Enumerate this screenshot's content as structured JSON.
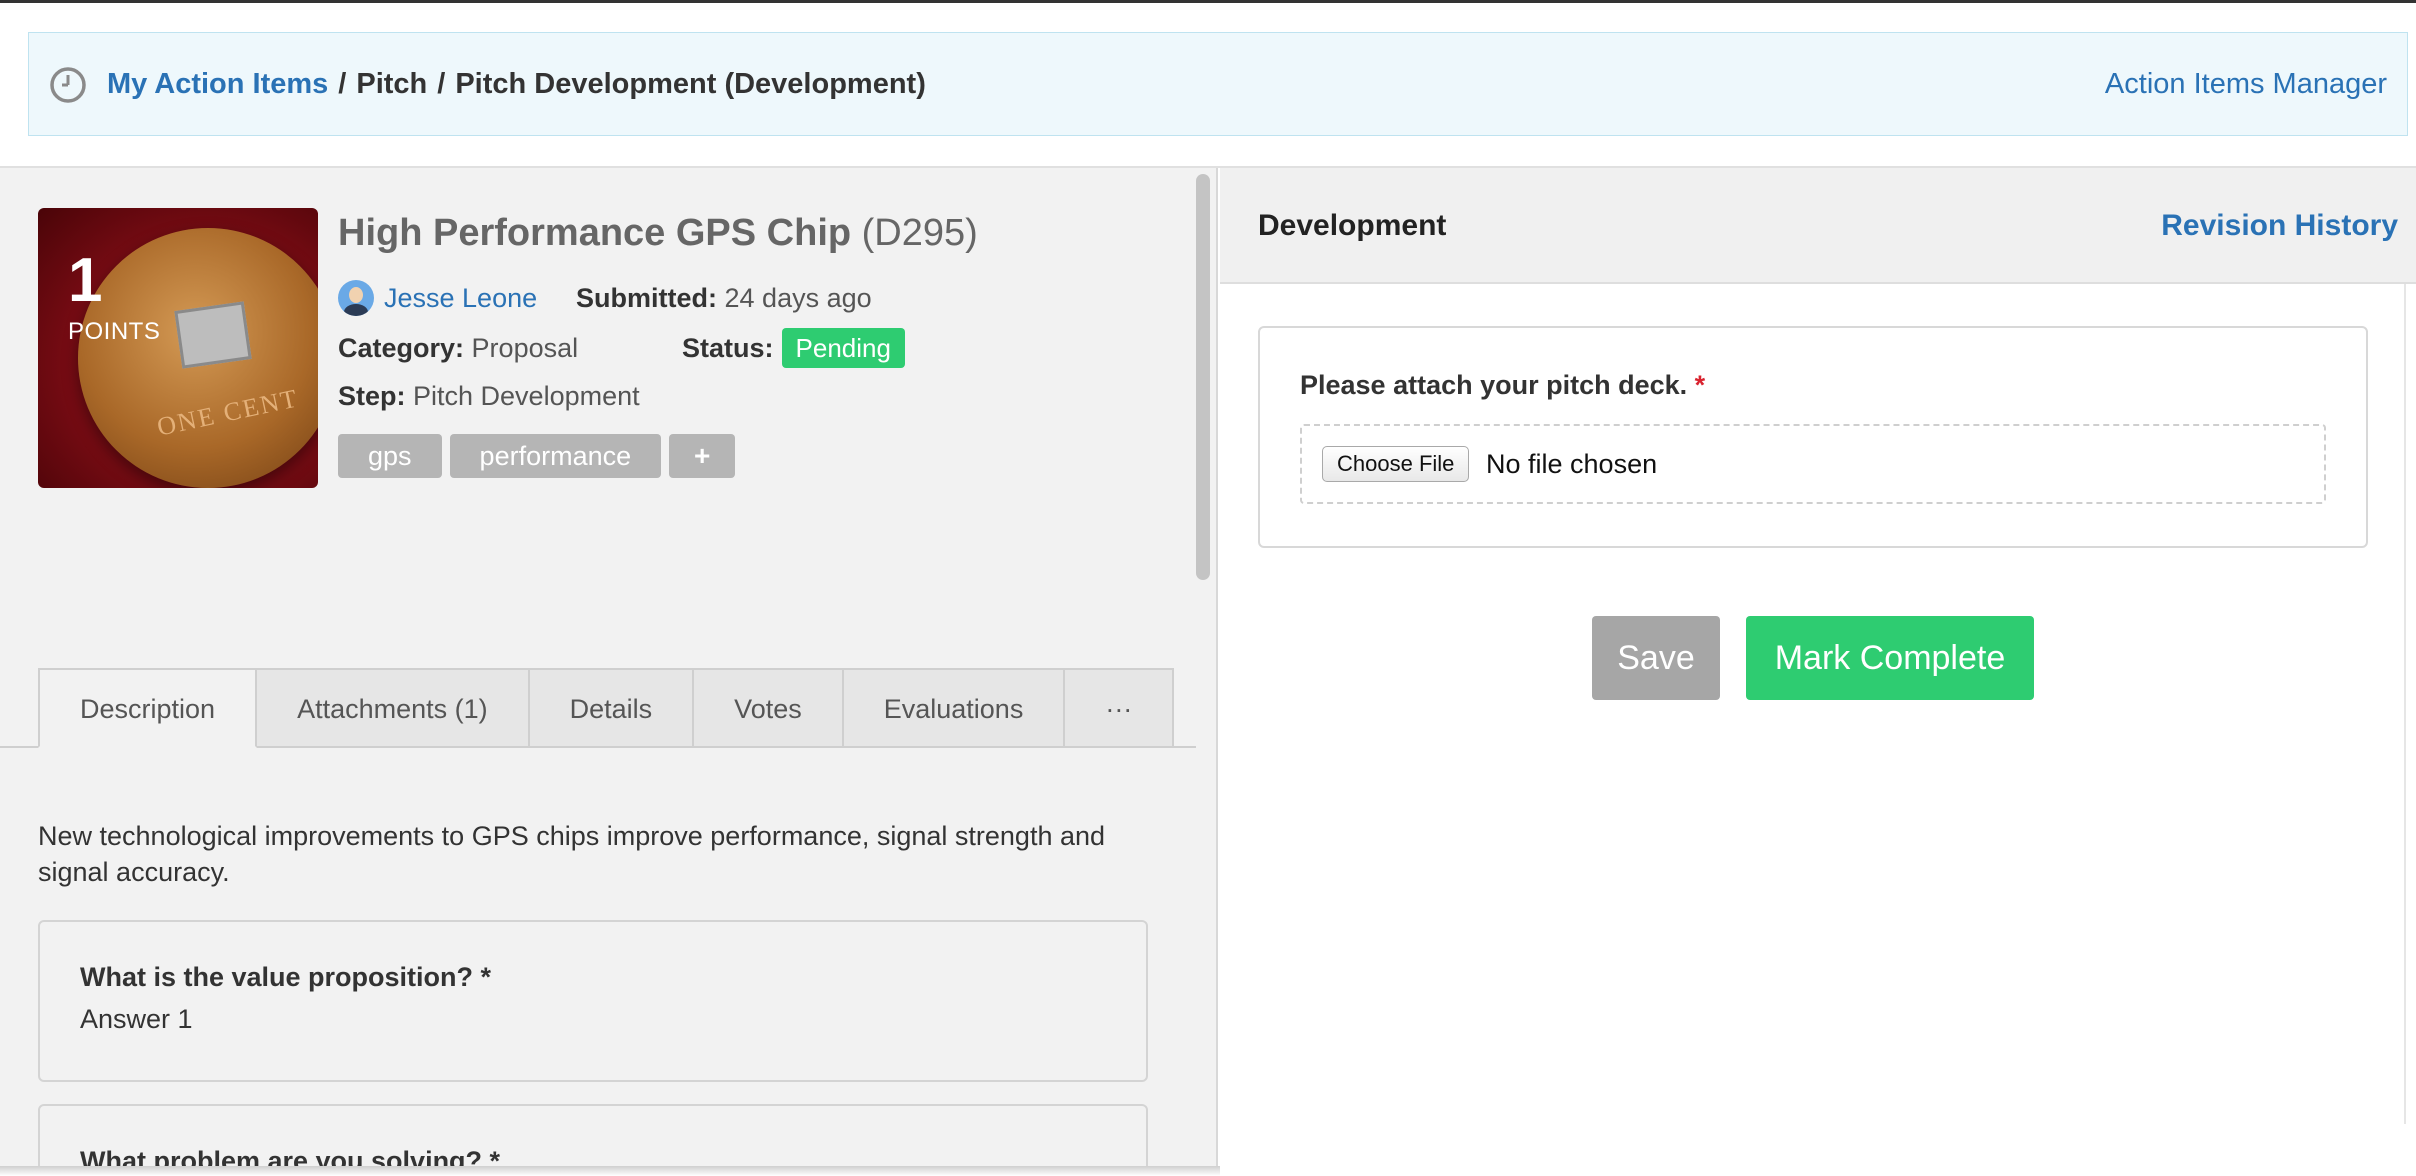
{
  "breadcrumb": {
    "home_link": "My Action Items",
    "separator": "/",
    "crumb2": "Pitch",
    "crumb3": "Pitch Development (Development)",
    "manager_link": "Action Items Manager"
  },
  "idea": {
    "points_value": "1",
    "points_label": "POINTS",
    "thumbnail_caption": "ONE CENT",
    "title": "High Performance GPS Chip",
    "code": "(D295)",
    "author": "Jesse Leone",
    "submitted_label": "Submitted:",
    "submitted_value": "24 days ago",
    "category_label": "Category:",
    "category_value": "Proposal",
    "status_label": "Status:",
    "status_value": "Pending",
    "step_label": "Step:",
    "step_value": "Pitch Development",
    "tags": [
      "gps",
      "performance"
    ],
    "add_tag_label": "+"
  },
  "tabs": [
    {
      "label": "Description",
      "active": true
    },
    {
      "label": "Attachments (1)",
      "active": false
    },
    {
      "label": "Details",
      "active": false
    },
    {
      "label": "Votes",
      "active": false
    },
    {
      "label": "Evaluations",
      "active": false
    },
    {
      "label": "···",
      "active": false
    }
  ],
  "description": "New technological improvements to GPS chips improve performance, signal strength and signal accuracy.",
  "questions": [
    {
      "label": "What is the value proposition? *",
      "answer": "Answer 1"
    },
    {
      "label": "What problem are you solving? *",
      "answer": ""
    }
  ],
  "right_panel": {
    "title": "Development",
    "history_link": "Revision History",
    "form_label": "Please attach your pitch deck.",
    "required_mark": "*",
    "choose_file_label": "Choose File",
    "no_file_text": "No file chosen",
    "save_label": "Save",
    "complete_label": "Mark Complete"
  },
  "colors": {
    "link": "#2a72b5",
    "success": "#2ecc71",
    "muted_button": "#a6a6a6",
    "required": "#d9232f",
    "breadcrumb_bg": "#eef8fc"
  }
}
